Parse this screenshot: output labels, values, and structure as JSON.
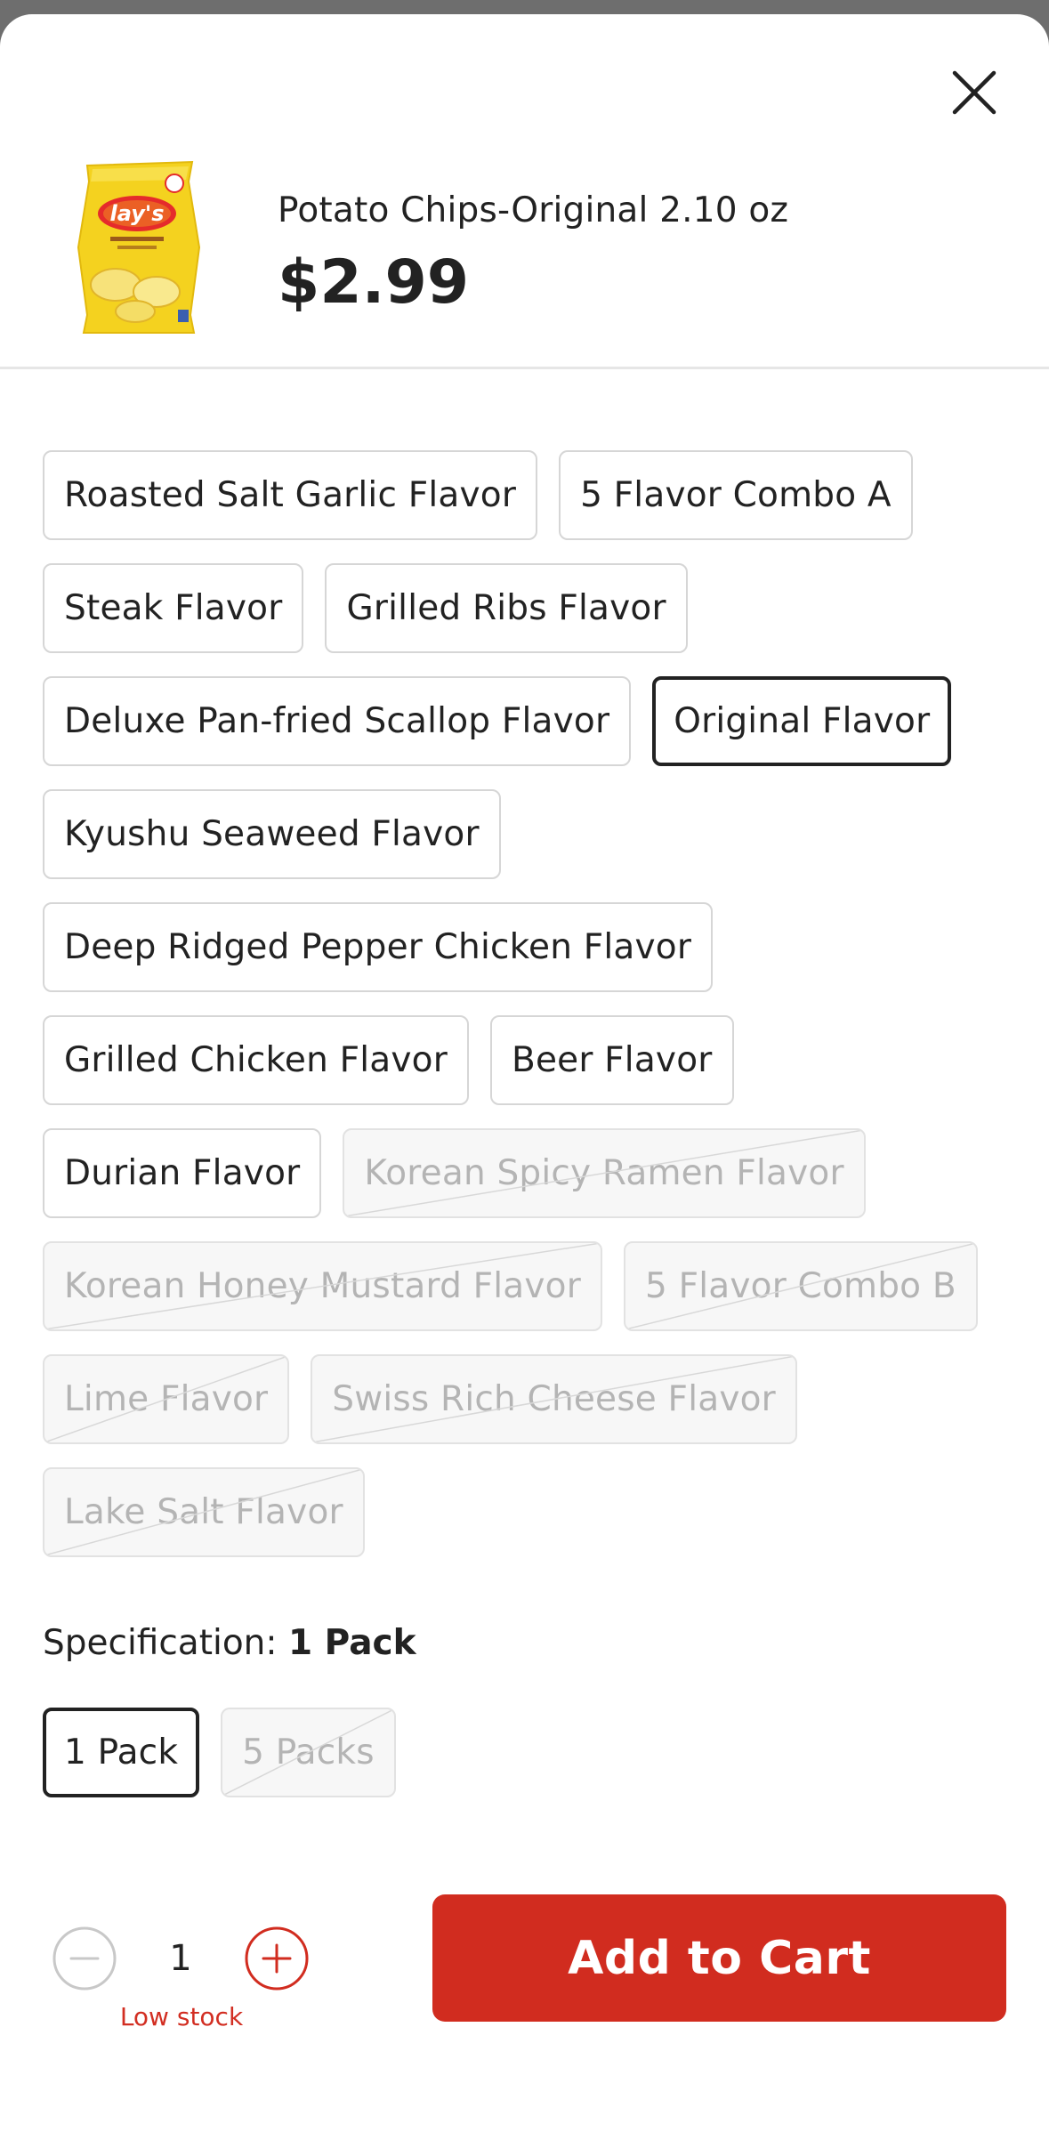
{
  "product": {
    "name": "Potato Chips-Original 2.10 oz",
    "price": "$2.99",
    "image_icon": "chips-bag-image",
    "brand_text": "lay's"
  },
  "close_icon": "close-icon",
  "flavors": [
    {
      "label": "Roasted Salt Garlic Flavor",
      "state": "available"
    },
    {
      "label": "5 Flavor Combo A",
      "state": "available"
    },
    {
      "label": "Steak Flavor",
      "state": "available"
    },
    {
      "label": "Grilled Ribs Flavor",
      "state": "available"
    },
    {
      "label": "Deluxe Pan-fried Scallop Flavor",
      "state": "available"
    },
    {
      "label": "Original Flavor",
      "state": "selected"
    },
    {
      "label": "Kyushu Seaweed Flavor",
      "state": "available"
    },
    {
      "label": "Deep Ridged Pepper Chicken Flavor",
      "state": "available"
    },
    {
      "label": "Grilled Chicken Flavor",
      "state": "available"
    },
    {
      "label": "Beer Flavor",
      "state": "available"
    },
    {
      "label": "Durian Flavor",
      "state": "available"
    },
    {
      "label": "Korean Spicy Ramen Flavor",
      "state": "unavailable"
    },
    {
      "label": "Korean Honey Mustard Flavor",
      "state": "unavailable"
    },
    {
      "label": "5 Flavor Combo B",
      "state": "unavailable"
    },
    {
      "label": "Lime Flavor",
      "state": "unavailable"
    },
    {
      "label": "Swiss Rich Cheese Flavor",
      "state": "unavailable"
    },
    {
      "label": "Lake Salt Flavor",
      "state": "unavailable"
    }
  ],
  "specification": {
    "label": "Specification:",
    "selected_value": "1 Pack",
    "options": [
      {
        "label": "1 Pack",
        "state": "selected"
      },
      {
        "label": "5 Packs",
        "state": "unavailable"
      }
    ]
  },
  "quantity": {
    "value": "1",
    "stock_note": "Low stock",
    "minus_icon": "minus-circle-icon",
    "plus_icon": "plus-circle-icon"
  },
  "cart": {
    "button_label": "Add to Cart"
  },
  "colors": {
    "accent": "#d12c1f",
    "selected_border": "#222222",
    "disabled_text": "#b4b4b4",
    "low_stock": "#d22e22"
  }
}
